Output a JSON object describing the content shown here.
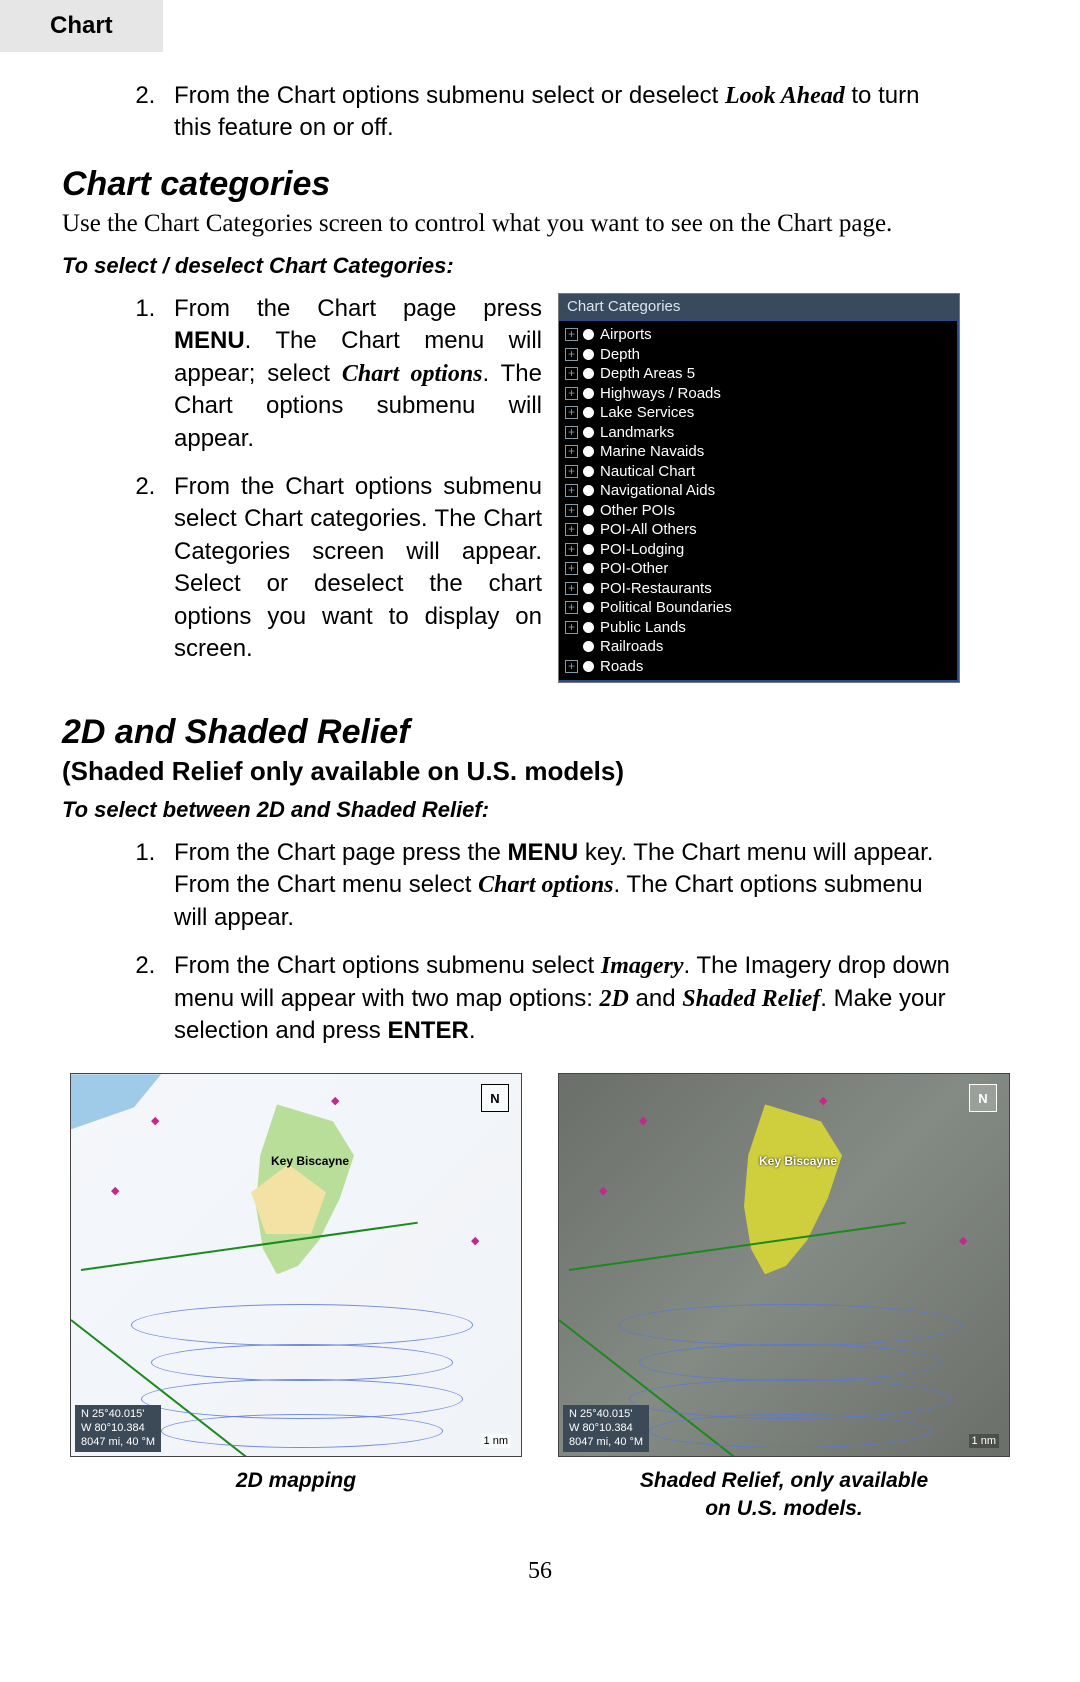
{
  "tab_label": "Chart",
  "intro_step": {
    "num": "2.",
    "pre": "From the Chart options submenu select or deselect ",
    "em": "Look Ahead",
    "post": " to turn this feature on or off."
  },
  "sec1": {
    "heading": "Chart categories",
    "desc": "Use the Chart Categories screen to control what you want to see on the Chart page.",
    "sub": "To select / deselect Chart Categories:",
    "step1": {
      "a": "From the Chart page press ",
      "b": "MENU",
      "c": ". The Chart menu will appear; select ",
      "d": "Chart options",
      "e": ". The Chart options submenu will appear."
    },
    "step2": "From the Chart options submenu select Chart categories. The Chart Categories screen will appear. Select or deselect the chart options you want to display on screen."
  },
  "categories": {
    "title": "Chart Categories",
    "items": [
      {
        "exp": "+",
        "dot": true,
        "label": "Airports"
      },
      {
        "exp": "+",
        "dot": true,
        "label": "Depth"
      },
      {
        "exp": "+",
        "dot": true,
        "label": "Depth Areas 5"
      },
      {
        "exp": "+",
        "dot": true,
        "label": "Highways / Roads"
      },
      {
        "exp": "+",
        "dot": true,
        "label": "Lake Services"
      },
      {
        "exp": "+",
        "dot": true,
        "label": "Landmarks"
      },
      {
        "exp": "+",
        "dot": true,
        "label": "Marine Navaids"
      },
      {
        "exp": "+",
        "dot": true,
        "label": "Nautical Chart"
      },
      {
        "exp": "+",
        "dot": true,
        "label": "Navigational Aids"
      },
      {
        "exp": "+",
        "dot": true,
        "label": "Other POIs"
      },
      {
        "exp": "+",
        "dot": true,
        "label": "POI-All Others"
      },
      {
        "exp": "+",
        "dot": true,
        "label": "POI-Lodging"
      },
      {
        "exp": "+",
        "dot": true,
        "label": "POI-Other"
      },
      {
        "exp": "+",
        "dot": true,
        "label": "POI-Restaurants"
      },
      {
        "exp": "+",
        "dot": true,
        "label": "Political Boundaries"
      },
      {
        "exp": "+",
        "dot": true,
        "label": "Public Lands"
      },
      {
        "exp": "",
        "dot": true,
        "label": "Railroads"
      },
      {
        "exp": "+",
        "dot": true,
        "label": "Roads"
      }
    ]
  },
  "sec2": {
    "heading": "2D and Shaded Relief",
    "subtitle": "(Shaded Relief only available on U.S. models)",
    "sub": "To select between 2D and Shaded Relief:",
    "step1": {
      "a": "From the Chart page press the ",
      "b": "MENU",
      "c": " key. The Chart menu will appear. From the Chart menu select ",
      "d": "Chart options",
      "e": ". The Chart options submenu will appear."
    },
    "step2": {
      "a": "From the Chart options submenu select ",
      "b": "Imagery",
      "c": ". The Imagery drop down menu will appear with two map options: ",
      "d": "2D",
      "e": " and ",
      "f": "Shaded Relief",
      "g": ". Make your selection and press ",
      "h": "ENTER",
      "i": "."
    }
  },
  "figures": {
    "key_label": "Key Biscayne",
    "coords": {
      "lat": "N  25°40.015'",
      "lon": "W  80°10.384",
      "dist": "8047 mi, 40 °M"
    },
    "north": "N",
    "scale": "1 nm",
    "caption_left": "2D mapping",
    "caption_right_l1": "Shaded Relief, only available",
    "caption_right_l2": "on U.S. models."
  },
  "page_number": "56"
}
